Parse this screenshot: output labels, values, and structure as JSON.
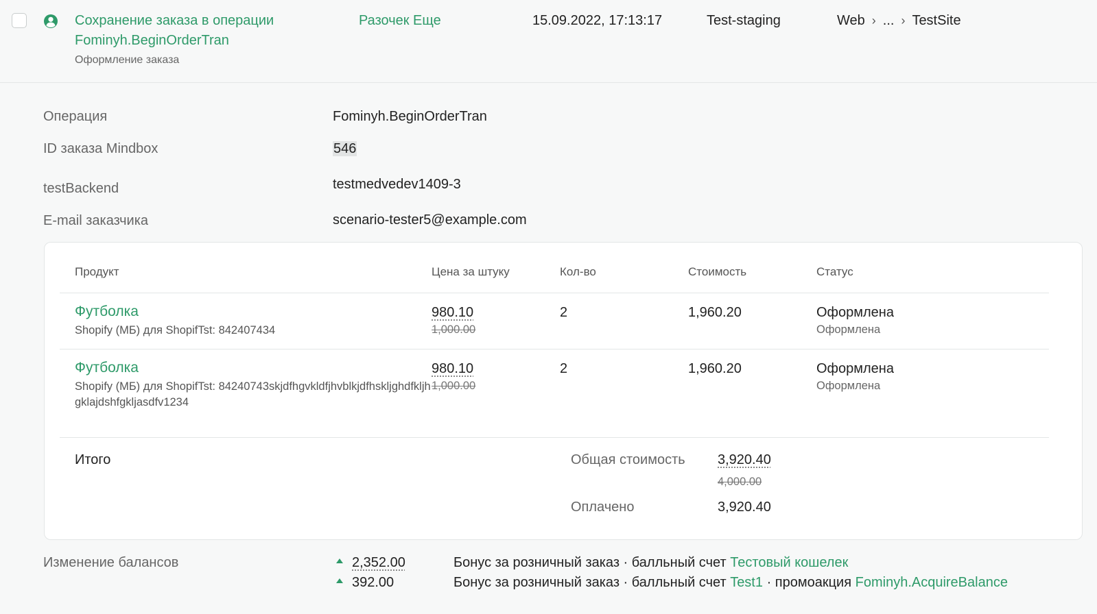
{
  "header": {
    "title_line1": "Сохранение заказа в операции",
    "title_line2": "Fominyh.BeginOrderTran",
    "subtitle": "Оформление заказа",
    "customer": "Разочек Еще",
    "timestamp": "15.09.2022, 17:13:17",
    "environment": "Test-staging",
    "breadcrumb": [
      "Web",
      "...",
      "TestSite"
    ],
    "icon": "user-circle-icon"
  },
  "details": {
    "operation_label": "Операция",
    "operation_value": "Fominyh.BeginOrderTran",
    "order_id_label": "ID заказа Mindbox",
    "order_id_value": "546",
    "backend_label": "testBackend",
    "backend_value": "testmedvedev1409-3",
    "email_label": "E-mail заказчика",
    "email_value": "scenario-tester5@example.com"
  },
  "table": {
    "headers": {
      "product": "Продукт",
      "unit_price": "Цена за штуку",
      "qty": "Кол-во",
      "cost": "Стоимость",
      "status": "Статус"
    },
    "rows": [
      {
        "name": "Футболка",
        "sub": "Shopify (МБ) для ShopifTst: 842407434",
        "price": "980.10",
        "old_price": "1,000.00",
        "qty": "2",
        "cost": "1,960.20",
        "status": "Оформлена",
        "status_sub": "Оформлена"
      },
      {
        "name": "Футболка",
        "sub": "Shopify (МБ) для ShopifTst: 84240743skjdfhgvkldfjhvblkjdfhskljghdfkljhgklajdshfgkljasdfv1234",
        "price": "980.10",
        "old_price": "1,000.00",
        "qty": "2",
        "cost": "1,960.20",
        "status": "Оформлена",
        "status_sub": "Оформлена"
      }
    ],
    "totals": {
      "label": "Итого",
      "total_cost_label": "Общая стоимость",
      "total_cost": "3,920.40",
      "total_cost_old": "4,000.00",
      "paid_label": "Оплачено",
      "paid": "3,920.40"
    }
  },
  "balances": {
    "label": "Изменение балансов",
    "items": [
      {
        "amount": "2,352.00",
        "text": "Бонус за розничный заказ · балльный счет",
        "account": "Тестовый кошелек",
        "promo_text": "",
        "promo": ""
      },
      {
        "amount": "392.00",
        "text": "Бонус за розничный заказ · балльный счет",
        "account": "Test1",
        "promo_text": "· промоакция",
        "promo": "Fominyh.AcquireBalance"
      }
    ]
  },
  "colors": {
    "accent": "#2e9a69",
    "background": "#f7f8f8",
    "card": "#ffffff"
  }
}
